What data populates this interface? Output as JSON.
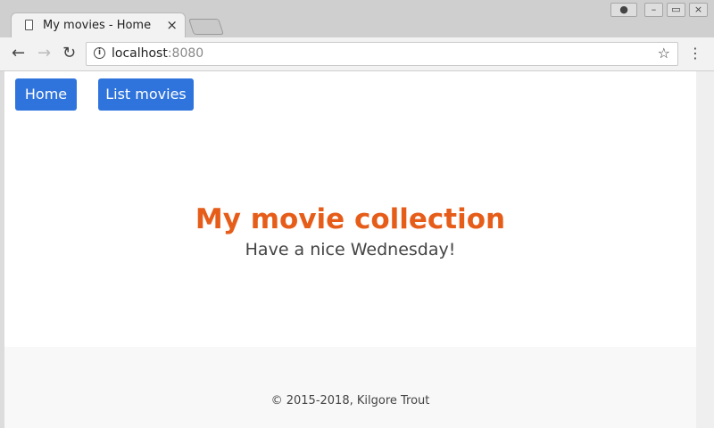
{
  "browser": {
    "tab_title": "My movies - Home",
    "close_glyph": "×",
    "url_host": "localhost",
    "url_port": ":8080",
    "back_glyph": "←",
    "forward_glyph": "→",
    "reload_glyph": "↻",
    "star_glyph": "☆",
    "menu_glyph": "⋮",
    "info_glyph": "i",
    "win_profile_glyph": "●",
    "win_min_glyph": "–",
    "win_max_glyph": "▭",
    "win_close_glyph": "×"
  },
  "nav": {
    "home_label": "Home",
    "list_label": "List movies"
  },
  "hero": {
    "title": "My movie collection",
    "subtitle": "Have a nice Wednesday!"
  },
  "footer": {
    "text": "© 2015-2018, Kilgore Trout"
  },
  "colors": {
    "accent": "#2f74dc",
    "title": "#e65d1a"
  }
}
